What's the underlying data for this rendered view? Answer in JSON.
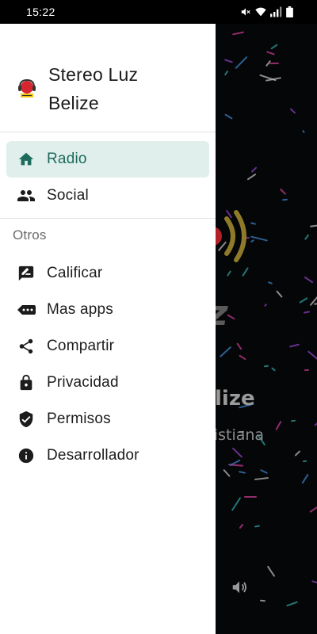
{
  "status_bar": {
    "time": "15:22",
    "icons": [
      "mute-icon",
      "wifi-icon",
      "signal-icon",
      "battery-icon"
    ]
  },
  "drawer": {
    "app_name": "Stereo Luz Belize",
    "logo_icon": "radio-logo-icon",
    "main_items": [
      {
        "label": "Radio",
        "icon": "home-icon",
        "active": true
      },
      {
        "label": "Social",
        "icon": "people-icon",
        "active": false
      }
    ],
    "section_title": "Otros",
    "other_items": [
      {
        "label": "Calificar",
        "icon": "rate-review-icon"
      },
      {
        "label": "Mas apps",
        "icon": "more-apps-icon"
      },
      {
        "label": "Compartir",
        "icon": "share-icon"
      },
      {
        "label": "Privacidad",
        "icon": "lock-icon"
      },
      {
        "label": "Permisos",
        "icon": "shield-check-icon"
      },
      {
        "label": "Desarrollador",
        "icon": "info-icon"
      }
    ]
  },
  "background": {
    "title_fragment": "lize",
    "subtitle_fragment": "ristiana",
    "z_fragment": "z"
  },
  "colors": {
    "accent": "#1d6b5c",
    "active_bg": "#e0eeec",
    "drawer_bg": "#ffffff",
    "overlay_bg": "#050608"
  }
}
